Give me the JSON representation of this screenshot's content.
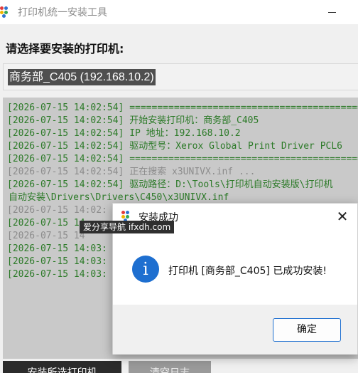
{
  "window": {
    "title": "打印机统一安装工具",
    "icon": "app-dots-icon"
  },
  "prompt": "请选择要安装的打印机:",
  "printer_select": {
    "value": "商务部_C405 (192.168.10.2)"
  },
  "log": {
    "lines": [
      {
        "ts": "[2026-07-15 14:02:54]",
        "text": " ============================================"
      },
      {
        "ts": "[2026-07-15 14:02:54]",
        "text": " 开始安装打印机：商务部_C405"
      },
      {
        "ts": "[2026-07-15 14:02:54]",
        "text": " IP 地址：192.168.10.2"
      },
      {
        "ts": "[2026-07-15 14:02:54]",
        "text": " 驱动型号：Xerox Global Print Driver PCL6"
      },
      {
        "ts": "[2026-07-15 14:02:54]",
        "text": " ============================================"
      },
      {
        "ts": "[2026-07-15 14:02:54]",
        "text": " 正在搜索 x3UNIVX.inf ..."
      },
      {
        "ts": "[2026-07-15 14:02:54]",
        "text": " 驱动路径：D:\\Tools\\打印机自动安装版\\打印机"
      },
      {
        "ts": "",
        "text": "自动安装\\Drivers\\Drivers\\C450\\x3UNIVX.inf"
      },
      {
        "ts": "[2026-07-15 14:02:",
        "text": ""
      },
      {
        "ts": "[2026-07-15 14",
        "text": ""
      },
      {
        "ts": "[2026-07-15 14",
        "text": ""
      },
      {
        "ts": "[2026-07-15 14:03:",
        "text": ""
      },
      {
        "ts": "[2026-07-15 14:03:",
        "text": ""
      },
      {
        "ts": "[2026-07-15 14:03:",
        "text": ""
      }
    ],
    "colors": {
      "normal": "#2c7a28",
      "muted": "#8c8c8c",
      "background": "#c9c9c9"
    }
  },
  "buttons": {
    "install": "安装所选打印机",
    "clear_log": "清空日志"
  },
  "watermark": "爱分享导航 ifxdh.com",
  "dialog": {
    "title": "安装成功",
    "close_glyph": "✕",
    "info_glyph": "i",
    "message": "打印机 [商务部_C405] 已成功安装!",
    "ok_label": "确定",
    "accent": "#1e6fd0"
  }
}
